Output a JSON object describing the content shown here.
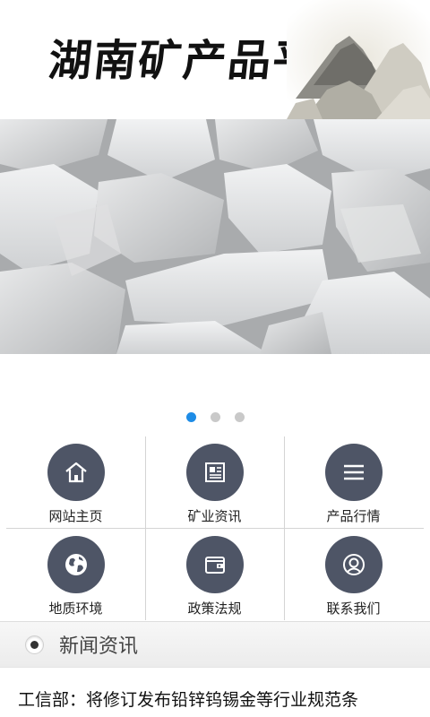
{
  "header": {
    "title": "湖南矿产品平台"
  },
  "carousel": {
    "slide_count": 3,
    "active_index": 0,
    "active_color": "#1e8ce6",
    "inactive_color": "#c9c9c9"
  },
  "nav": {
    "icon_color": "#4e5566",
    "items": [
      {
        "label": "网站主页",
        "icon": "home-icon"
      },
      {
        "label": "矿业资讯",
        "icon": "newspaper-icon"
      },
      {
        "label": "产品行情",
        "icon": "menu-lines-icon"
      },
      {
        "label": "地质环境",
        "icon": "globe-icon"
      },
      {
        "label": "政策法规",
        "icon": "wallet-icon"
      },
      {
        "label": "联系我们",
        "icon": "user-icon"
      }
    ]
  },
  "news": {
    "section_title": "新闻资讯",
    "items": [
      {
        "title": "工信部：将修订发布铅锌钨锡金等行业规范条"
      }
    ]
  }
}
